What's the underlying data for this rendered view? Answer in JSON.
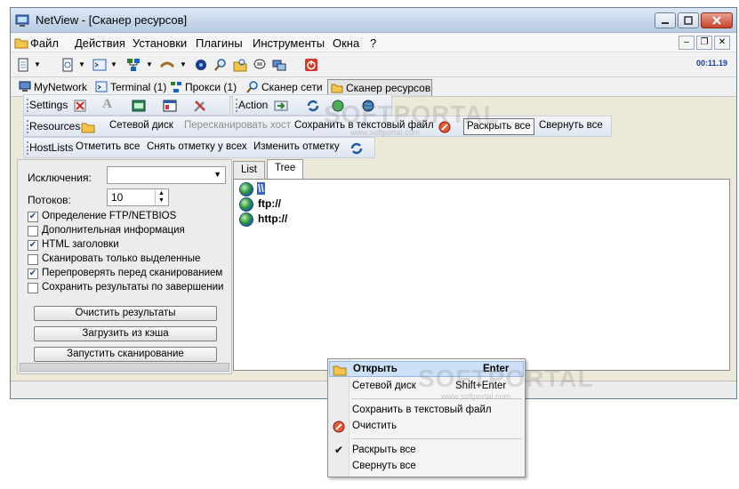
{
  "window": {
    "title": "NetView - [Сканер ресурсов]"
  },
  "menu": {
    "items": [
      "Файл",
      "Действия",
      "Установки",
      "Плагины",
      "Инструменты",
      "Окна",
      "?"
    ]
  },
  "toolbar": {
    "clock": "00:11.19"
  },
  "doc_tabs": [
    {
      "label": "MyNetwork",
      "icon": "computer-icon"
    },
    {
      "label": "Terminal (1)",
      "icon": "terminal-icon"
    },
    {
      "label": "Прокси (1)",
      "icon": "proxy-icon"
    },
    {
      "label": "Сканер сети",
      "icon": "magnifier-icon"
    },
    {
      "label": "Сканер ресурсов",
      "icon": "folder-icon",
      "active": true
    }
  ],
  "bands": {
    "settings": {
      "label": "Settings"
    },
    "action": {
      "label": "Action"
    },
    "resources": {
      "label": "Resources",
      "net_disk": "Сетевой диск",
      "rescan": "Пересканировать хост",
      "save_txt": "Сохранить в текстовый файл",
      "expand": "Раскрыть все",
      "collapse": "Свернуть все"
    },
    "hostlists": {
      "label": "HostLists",
      "mark_all": "Отметить все",
      "unmark_all": "Снять отметку у всех",
      "change_mark": "Изменить отметку"
    }
  },
  "left": {
    "exclusions_label": "Исключения:",
    "exclusions_value": "",
    "threads_label": "Потоков:",
    "threads_value": "10",
    "options": [
      {
        "label": "Определение FTP/NETBIOS",
        "checked": true
      },
      {
        "label": "Дополнительная информация",
        "checked": false
      },
      {
        "label": "HTML заголовки",
        "checked": true
      },
      {
        "label": "Сканировать только выделенные",
        "checked": false
      },
      {
        "label": "Перепроверять перед сканированием",
        "checked": true
      },
      {
        "label": "Сохранить результаты по завершении",
        "checked": false
      }
    ],
    "buttons": {
      "clear": "Очистить результаты",
      "load_cache": "Загрузить из кэша",
      "start": "Запустить сканирование"
    }
  },
  "right": {
    "tabs": [
      "List",
      "Tree"
    ],
    "tree_nodes": [
      "\\\\",
      "ftp://",
      "http://"
    ]
  },
  "context_menu": {
    "items": [
      {
        "label": "Открыть",
        "shortcut": "Enter",
        "icon": "folder-icon",
        "highlight": true
      },
      {
        "label": "Сетевой диск",
        "shortcut": "Shift+Enter",
        "icon": ""
      },
      {
        "label": "Сохранить в текстовый файл",
        "shortcut": "",
        "icon": ""
      },
      {
        "label": "Очистить",
        "shortcut": "",
        "icon": "clear-icon"
      },
      {
        "label": "Раскрыть все",
        "shortcut": "",
        "icon": "check-icon"
      },
      {
        "label": "Свернуть все",
        "shortcut": "",
        "icon": ""
      }
    ]
  },
  "watermark": {
    "big": "SOFTPORTAL",
    "small": "www.softportal.com"
  }
}
